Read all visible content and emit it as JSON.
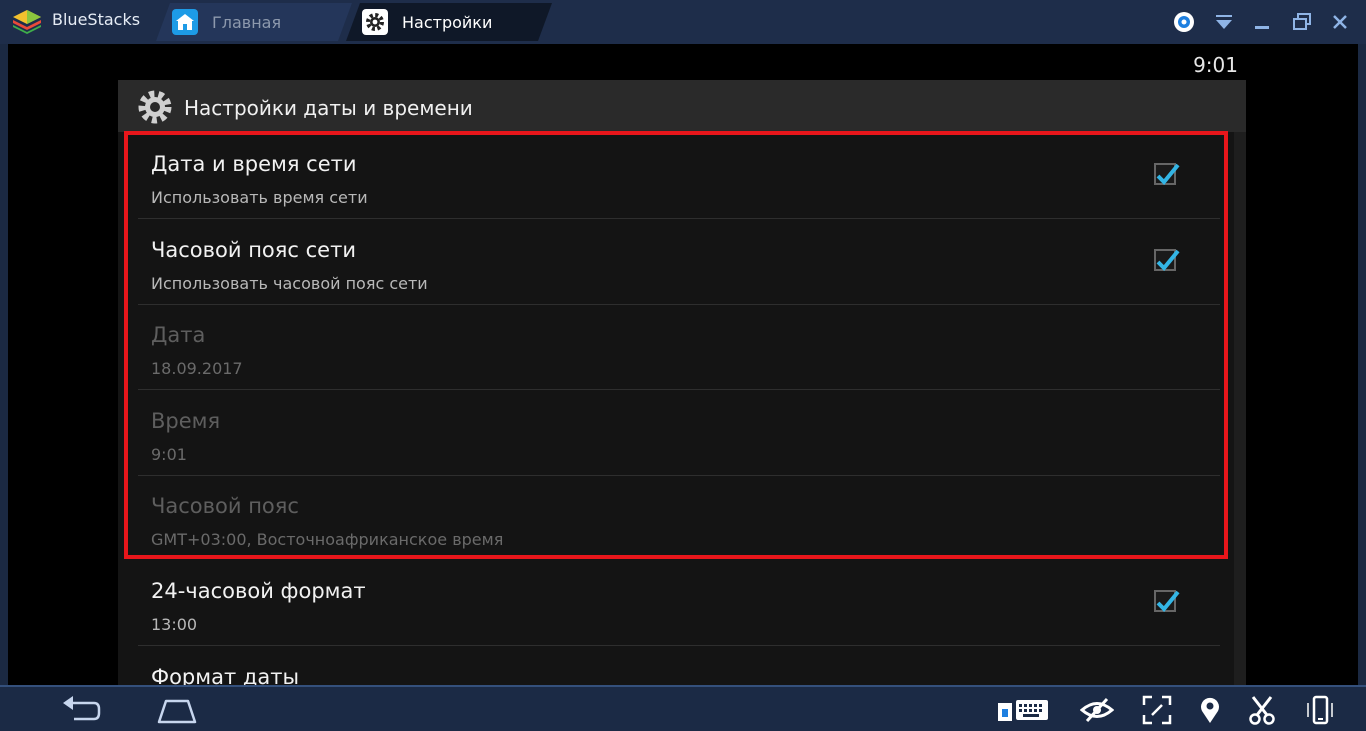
{
  "app": {
    "brand": "BlueStacks",
    "tabs": [
      {
        "label": "Главная",
        "icon": "home-icon"
      },
      {
        "label": "Настройки",
        "icon": "gear-icon"
      }
    ]
  },
  "status_bar": {
    "time": "9:01"
  },
  "settings": {
    "title": "Настройки даты и времени",
    "items": [
      {
        "title": "Дата и время сети",
        "subtitle": "Использовать время сети",
        "checked": true,
        "enabled": true
      },
      {
        "title": "Часовой пояс сети",
        "subtitle": "Использовать часовой пояс сети",
        "checked": true,
        "enabled": true
      },
      {
        "title": "Дата",
        "subtitle": "18.09.2017",
        "enabled": false
      },
      {
        "title": "Время",
        "subtitle": "9:01",
        "enabled": false
      },
      {
        "title": "Часовой пояс",
        "subtitle": "GMT+03:00, Восточноафриканское время",
        "enabled": false
      },
      {
        "title": "24-часовой формат",
        "subtitle": "13:00",
        "checked": true,
        "enabled": true
      },
      {
        "title": "Формат даты",
        "subtitle": "",
        "enabled": true
      }
    ]
  },
  "colors": {
    "highlight": "#e8161b",
    "check": "#33b5e5",
    "titlebar": "#1e2d4a"
  }
}
